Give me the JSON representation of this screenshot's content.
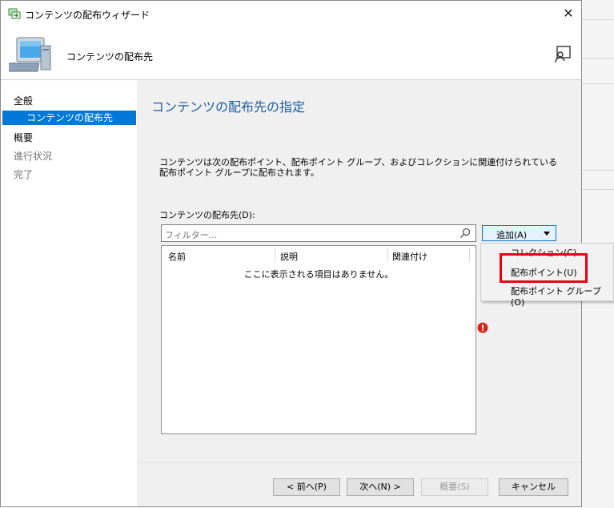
{
  "window": {
    "title": "コンテンツの配布ウィザード",
    "header_title": "コンテンツの配布先",
    "close_glyph": "✕"
  },
  "nav": {
    "items": [
      {
        "label": "全般",
        "state": "normal"
      },
      {
        "label": "コンテンツの配布先",
        "state": "selected"
      },
      {
        "label": "概要",
        "state": "normal"
      },
      {
        "label": "進行状況",
        "state": "disabled"
      },
      {
        "label": "完了",
        "state": "disabled"
      }
    ]
  },
  "main": {
    "heading": "コンテンツの配布先の指定",
    "description": "コンテンツは次の配布ポイント、配布ポイント グループ、およびコレクションに関連付けられている配布ポイント グループに配布されます。",
    "list_label": "コンテンツの配布先(D):",
    "filter_placeholder": "フィルター...",
    "columns": [
      "名前",
      "説明",
      "関連付け"
    ],
    "empty_message": "ここに表示される項目はありません。",
    "add_button": "追加(A)"
  },
  "menu": {
    "items": [
      "コレクション(C)",
      "配布ポイント(U)",
      "配布ポイント グループ(O)"
    ],
    "highlighted_index": 1
  },
  "footer": {
    "back": "< 前へ(P)",
    "next": "次へ(N) >",
    "summary": "概要(S)",
    "cancel": "キャンセル"
  },
  "colors": {
    "accent": "#0078d7",
    "heading": "#1a5fa6",
    "highlight_box": "#e60012",
    "error": "#d9261c"
  }
}
